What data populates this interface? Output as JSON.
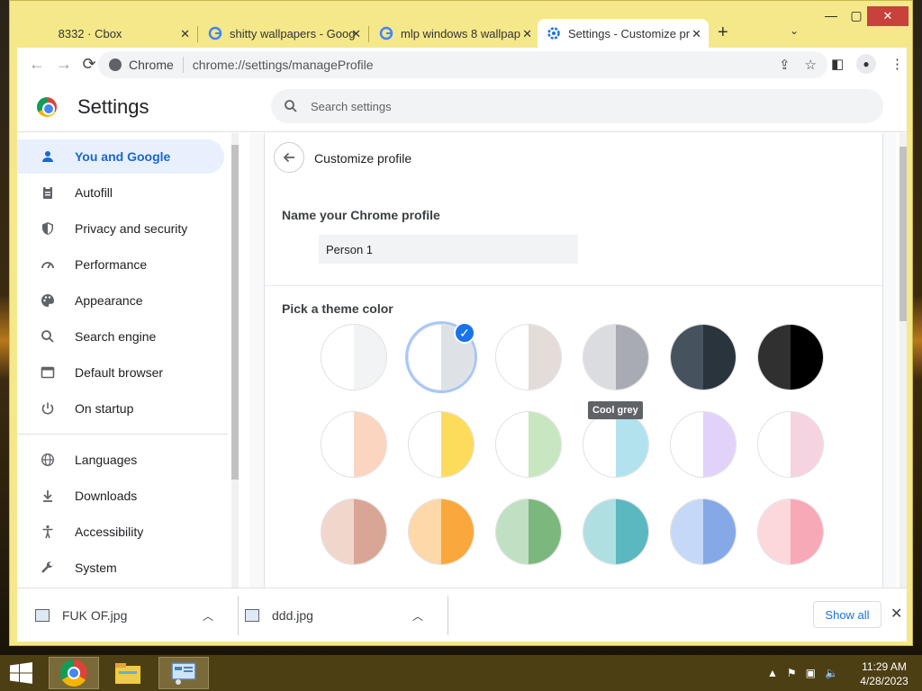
{
  "tabs": [
    {
      "title": "8332 · Cbox",
      "close": "✕"
    },
    {
      "title": "shitty wallpapers - Goog",
      "close": "✕"
    },
    {
      "title": "mlp windows 8 wallpap",
      "close": "✕"
    },
    {
      "title": "Settings - Customize pr",
      "close": "✕"
    }
  ],
  "window": {
    "minimize": "—",
    "maximize": "▢",
    "close": "✕",
    "new_tab": "+",
    "tab_menu": "⌄"
  },
  "toolbar": {
    "site_chip": "Chrome",
    "url": "chrome://settings/manageProfile"
  },
  "settings": {
    "title": "Settings",
    "search_placeholder": "Search settings"
  },
  "sidebar": {
    "items": [
      {
        "label": "You and Google",
        "icon": "person-icon"
      },
      {
        "label": "Autofill",
        "icon": "clipboard-icon"
      },
      {
        "label": "Privacy and security",
        "icon": "shield-icon"
      },
      {
        "label": "Performance",
        "icon": "speedometer-icon"
      },
      {
        "label": "Appearance",
        "icon": "palette-icon"
      },
      {
        "label": "Search engine",
        "icon": "search-icon"
      },
      {
        "label": "Default browser",
        "icon": "browser-icon"
      },
      {
        "label": "On startup",
        "icon": "power-icon"
      },
      {
        "label": "Languages",
        "icon": "globe-icon"
      },
      {
        "label": "Downloads",
        "icon": "download-icon"
      },
      {
        "label": "Accessibility",
        "icon": "accessibility-icon"
      },
      {
        "label": "System",
        "icon": "wrench-icon"
      }
    ]
  },
  "customize": {
    "title": "Customize profile",
    "name_label": "Name your Chrome profile",
    "name_value": "Person 1",
    "theme_label": "Pick a theme color",
    "tooltip": "Cool grey",
    "swatches": [
      {
        "left": "#ffffff",
        "right": "#f1f3f4",
        "selected": false
      },
      {
        "left": "#ffffff",
        "right": "#dee1e6",
        "selected": true
      },
      {
        "left": "#ffffff",
        "right": "#e3dcd8",
        "selected": false
      },
      {
        "left": "#dadce0",
        "right": "#a8abb3",
        "selected": false
      },
      {
        "left": "#46535e",
        "right": "#2a343c",
        "selected": false
      },
      {
        "left": "#303030",
        "right": "#000000",
        "selected": false
      },
      {
        "left": "#ffffff",
        "right": "#fbd5bf",
        "selected": false
      },
      {
        "left": "#ffffff",
        "right": "#fddc5c",
        "selected": false
      },
      {
        "left": "#ffffff",
        "right": "#c8e6c0",
        "selected": false
      },
      {
        "left": "#ffffff",
        "right": "#b3e2ef",
        "selected": false
      },
      {
        "left": "#ffffff",
        "right": "#e1d2fa",
        "selected": false
      },
      {
        "left": "#ffffff",
        "right": "#f6d3e0",
        "selected": false
      },
      {
        "left": "#f1d6cc",
        "right": "#d9a595",
        "selected": false
      },
      {
        "left": "#fdd8a8",
        "right": "#faa73b",
        "selected": false
      },
      {
        "left": "#bfe0c2",
        "right": "#7cb87e",
        "selected": false
      },
      {
        "left": "#b0dfe2",
        "right": "#5bb7c0",
        "selected": false
      },
      {
        "left": "#c6d8f7",
        "right": "#85a9e6",
        "selected": false
      },
      {
        "left": "#fcd8dd",
        "right": "#f7a9b7",
        "selected": false
      }
    ]
  },
  "downloads": {
    "items": [
      {
        "name": "FUK OF.jpg"
      },
      {
        "name": "ddd.jpg"
      }
    ],
    "show_all": "Show all",
    "close": "✕"
  },
  "taskbar": {
    "time": "11:29 AM",
    "date": "4/28/2023"
  }
}
